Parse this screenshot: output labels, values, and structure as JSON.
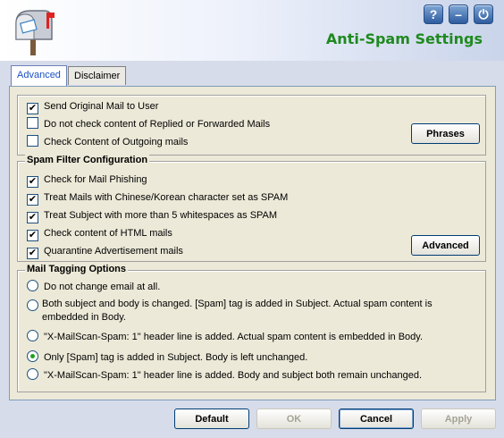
{
  "header": {
    "title": "Anti-Spam Settings",
    "help_label": "?",
    "minimize_label": "–",
    "power_label": "⏻"
  },
  "tabs": [
    {
      "label": "Advanced"
    },
    {
      "label": "Disclaimer"
    }
  ],
  "general": {
    "send_original": {
      "label": "Send Original Mail to User",
      "checked": true
    },
    "no_check_replied": {
      "label": "Do not check content of Replied or Forwarded Mails",
      "checked": false
    },
    "check_outgoing": {
      "label": "Check Content of Outgoing mails",
      "checked": false
    },
    "phrases_label": "Phrases"
  },
  "spam_filter": {
    "title": "Spam Filter Configuration",
    "items": [
      {
        "label": "Check for Mail Phishing",
        "checked": true
      },
      {
        "label": "Treat Mails with Chinese/Korean character set as SPAM",
        "checked": true
      },
      {
        "label": "Treat Subject with more than 5 whitespaces as SPAM",
        "checked": true
      },
      {
        "label": "Check content of HTML mails",
        "checked": true
      },
      {
        "label": "Quarantine Advertisement mails",
        "checked": true
      }
    ],
    "advanced_label": "Advanced"
  },
  "tagging": {
    "title": "Mail Tagging Options",
    "options": [
      {
        "label": "Do not change email at all.",
        "selected": false
      },
      {
        "label": "Both subject and body is changed.  [Spam] tag is added in Subject. Actual spam content is embedded in Body.",
        "selected": false
      },
      {
        "label": "\"X-MailScan-Spam: 1\" header line is added.  Actual spam content is embedded in Body.",
        "selected": false
      },
      {
        "label": "Only [Spam] tag is added in Subject. Body is left unchanged.",
        "selected": true
      },
      {
        "label": "\"X-MailScan-Spam: 1\" header line is added.  Body and subject both remain unchanged.",
        "selected": false
      }
    ]
  },
  "footer": {
    "default_label": "Default",
    "ok_label": "OK",
    "cancel_label": "Cancel",
    "apply_label": "Apply"
  },
  "colors": {
    "title_green": "#1f8a1f",
    "tab_active_text": "#1a4fc4",
    "radio_dot": "#21a121"
  }
}
